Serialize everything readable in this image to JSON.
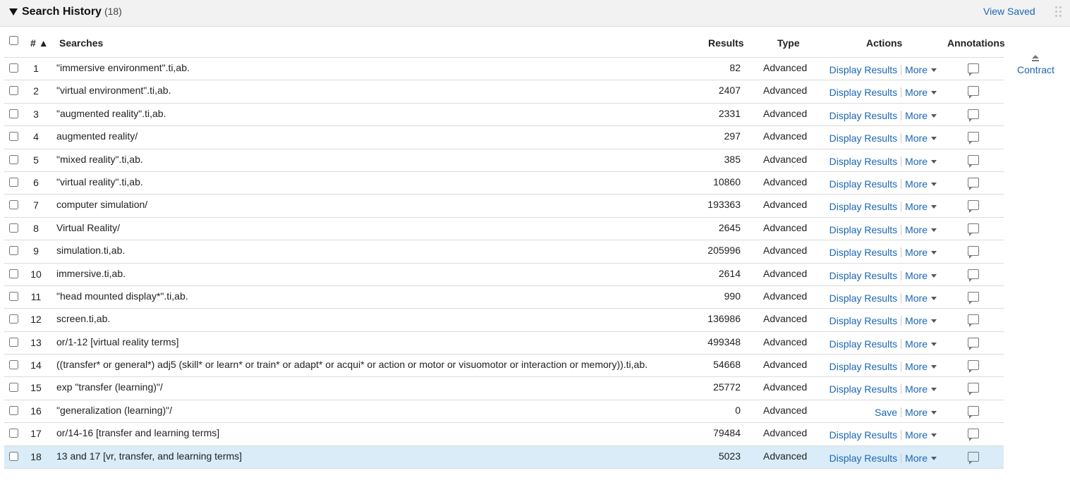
{
  "header": {
    "title": "Search History",
    "count": "(18)",
    "view_saved": "View Saved"
  },
  "columns": {
    "num": "#",
    "sort_indicator": "▲",
    "searches": "Searches",
    "results": "Results",
    "type": "Type",
    "actions": "Actions",
    "annotations": "Annotations"
  },
  "contract_label": "Contract",
  "rows": [
    {
      "num": "1",
      "search": "\"immersive environment\".ti,ab.",
      "results": "82",
      "type": "Advanced",
      "action": "Display Results",
      "more": "More"
    },
    {
      "num": "2",
      "search": "\"virtual environment\".ti,ab.",
      "results": "2407",
      "type": "Advanced",
      "action": "Display Results",
      "more": "More"
    },
    {
      "num": "3",
      "search": "\"augmented reality\".ti,ab.",
      "results": "2331",
      "type": "Advanced",
      "action": "Display Results",
      "more": "More"
    },
    {
      "num": "4",
      "search": "augmented reality/",
      "results": "297",
      "type": "Advanced",
      "action": "Display Results",
      "more": "More"
    },
    {
      "num": "5",
      "search": "\"mixed reality\".ti,ab.",
      "results": "385",
      "type": "Advanced",
      "action": "Display Results",
      "more": "More"
    },
    {
      "num": "6",
      "search": "\"virtual reality\".ti,ab.",
      "results": "10860",
      "type": "Advanced",
      "action": "Display Results",
      "more": "More"
    },
    {
      "num": "7",
      "search": "computer simulation/",
      "results": "193363",
      "type": "Advanced",
      "action": "Display Results",
      "more": "More"
    },
    {
      "num": "8",
      "search": "Virtual Reality/",
      "results": "2645",
      "type": "Advanced",
      "action": "Display Results",
      "more": "More"
    },
    {
      "num": "9",
      "search": "simulation.ti,ab.",
      "results": "205996",
      "type": "Advanced",
      "action": "Display Results",
      "more": "More"
    },
    {
      "num": "10",
      "search": "immersive.ti,ab.",
      "results": "2614",
      "type": "Advanced",
      "action": "Display Results",
      "more": "More"
    },
    {
      "num": "11",
      "search": "\"head mounted display*\".ti,ab.",
      "results": "990",
      "type": "Advanced",
      "action": "Display Results",
      "more": "More"
    },
    {
      "num": "12",
      "search": "screen.ti,ab.",
      "results": "136986",
      "type": "Advanced",
      "action": "Display Results",
      "more": "More"
    },
    {
      "num": "13",
      "search": "or/1-12 [virtual reality terms]",
      "results": "499348",
      "type": "Advanced",
      "action": "Display Results",
      "more": "More"
    },
    {
      "num": "14",
      "search": "((transfer* or general*) adj5 (skill* or learn* or train* or adapt* or acqui* or action or motor or visuomotor or interaction or memory)).ti,ab.",
      "results": "54668",
      "type": "Advanced",
      "action": "Display Results",
      "more": "More"
    },
    {
      "num": "15",
      "search": "exp \"transfer (learning)\"/",
      "results": "25772",
      "type": "Advanced",
      "action": "Display Results",
      "more": "More"
    },
    {
      "num": "16",
      "search": "\"generalization (learning)\"/",
      "results": "0",
      "type": "Advanced",
      "action": "Save",
      "more": "More"
    },
    {
      "num": "17",
      "search": "or/14-16 [transfer and learning terms]",
      "results": "79484",
      "type": "Advanced",
      "action": "Display Results",
      "more": "More"
    },
    {
      "num": "18",
      "search": "13 and 17 [vr, transfer, and learning terms]",
      "results": "5023",
      "type": "Advanced",
      "action": "Display Results",
      "more": "More",
      "selected": true
    }
  ]
}
